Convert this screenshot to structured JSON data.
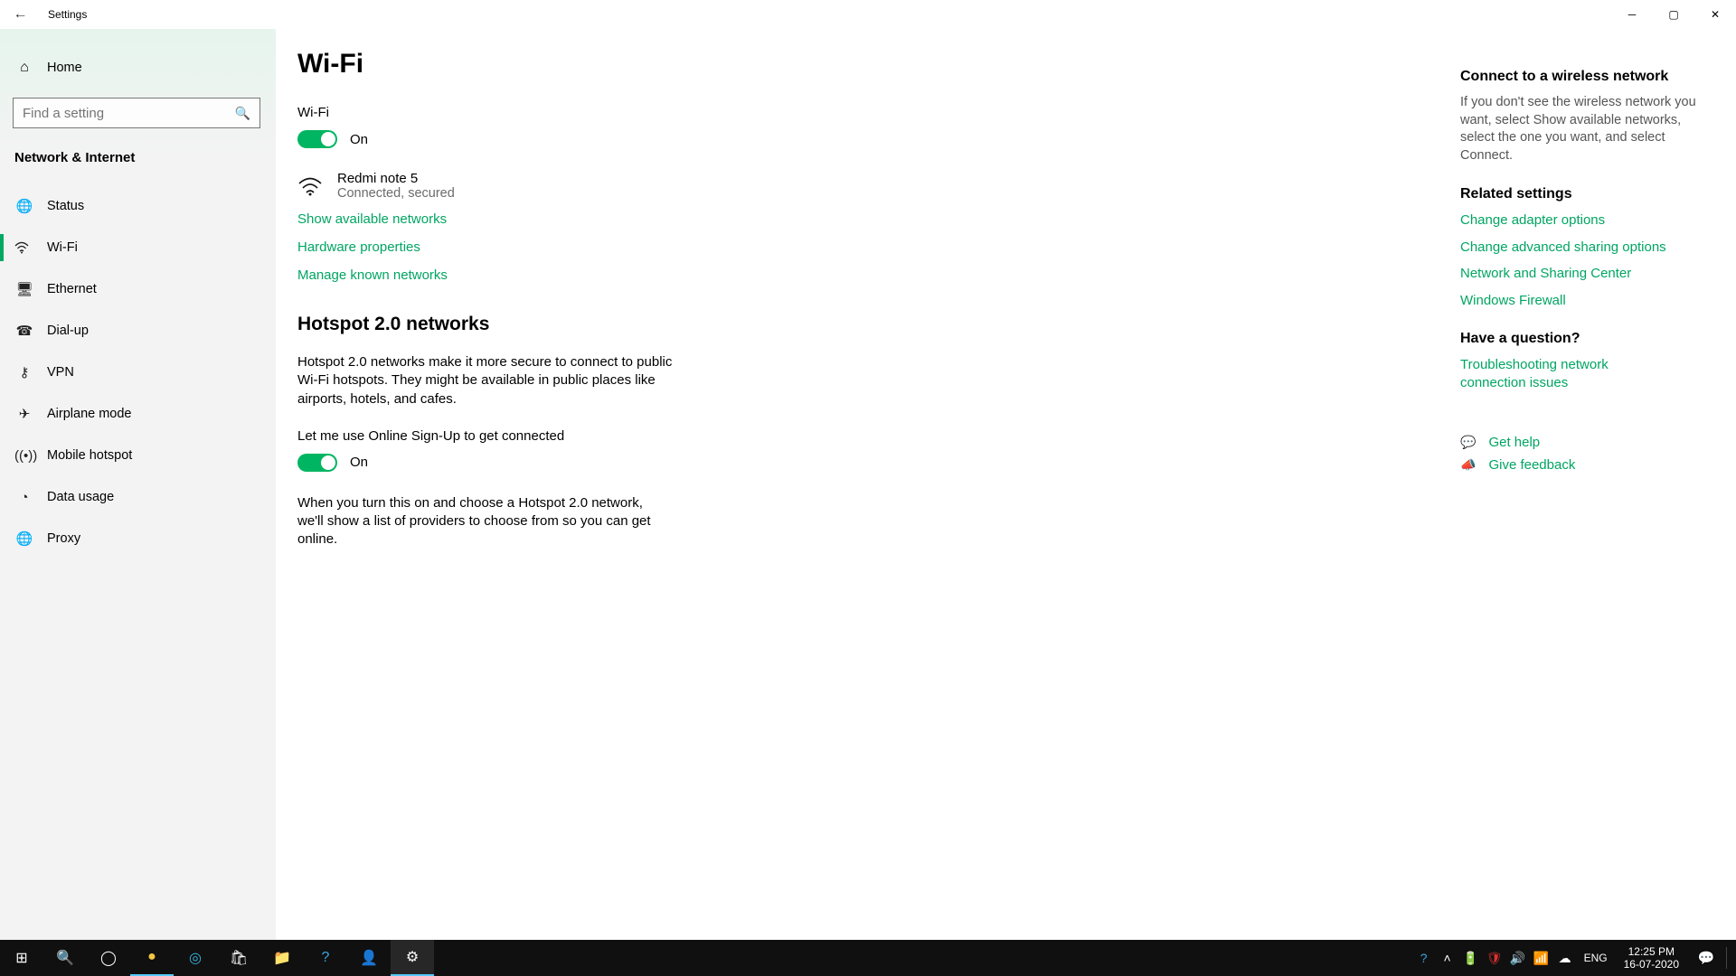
{
  "window": {
    "title": "Settings",
    "back_icon": "←"
  },
  "home": {
    "label": "Home"
  },
  "search": {
    "placeholder": "Find a setting"
  },
  "category": "Network & Internet",
  "nav": [
    {
      "id": "status",
      "label": "Status"
    },
    {
      "id": "wifi",
      "label": "Wi-Fi"
    },
    {
      "id": "ethernet",
      "label": "Ethernet"
    },
    {
      "id": "dialup",
      "label": "Dial-up"
    },
    {
      "id": "vpn",
      "label": "VPN"
    },
    {
      "id": "airplane",
      "label": "Airplane mode"
    },
    {
      "id": "hotspot",
      "label": "Mobile hotspot"
    },
    {
      "id": "datausage",
      "label": "Data usage"
    },
    {
      "id": "proxy",
      "label": "Proxy"
    }
  ],
  "page": {
    "title": "Wi-Fi",
    "wifi_label": "Wi-Fi",
    "wifi_state": "On",
    "network": {
      "name": "Redmi note 5",
      "status": "Connected, secured"
    },
    "links": {
      "show_available": "Show available networks",
      "hardware_props": "Hardware properties",
      "manage_known": "Manage known networks"
    },
    "hotspot": {
      "title": "Hotspot 2.0 networks",
      "desc": "Hotspot 2.0 networks make it more secure to connect to public Wi-Fi hotspots. They might be available in public places like airports, hotels, and cafes.",
      "signup_label": "Let me use Online Sign-Up to get connected",
      "signup_state": "On",
      "signup_desc": "When you turn this on and choose a Hotspot 2.0 network, we'll show a list of providers to choose from so you can get online."
    }
  },
  "right": {
    "connect_head": "Connect to a wireless network",
    "connect_text": "If you don't see the wireless network you want, select Show available networks, select the one you want, and select Connect.",
    "related_head": "Related settings",
    "related": {
      "adapter": "Change adapter options",
      "sharing": "Change advanced sharing options",
      "center": "Network and Sharing Center",
      "firewall": "Windows Firewall"
    },
    "question_head": "Have a question?",
    "troubleshoot": "Troubleshooting network connection issues",
    "gethelp": "Get help",
    "feedback": "Give feedback"
  },
  "taskbar": {
    "lang": "ENG",
    "time": "12:25 PM",
    "date": "16-07-2020"
  }
}
